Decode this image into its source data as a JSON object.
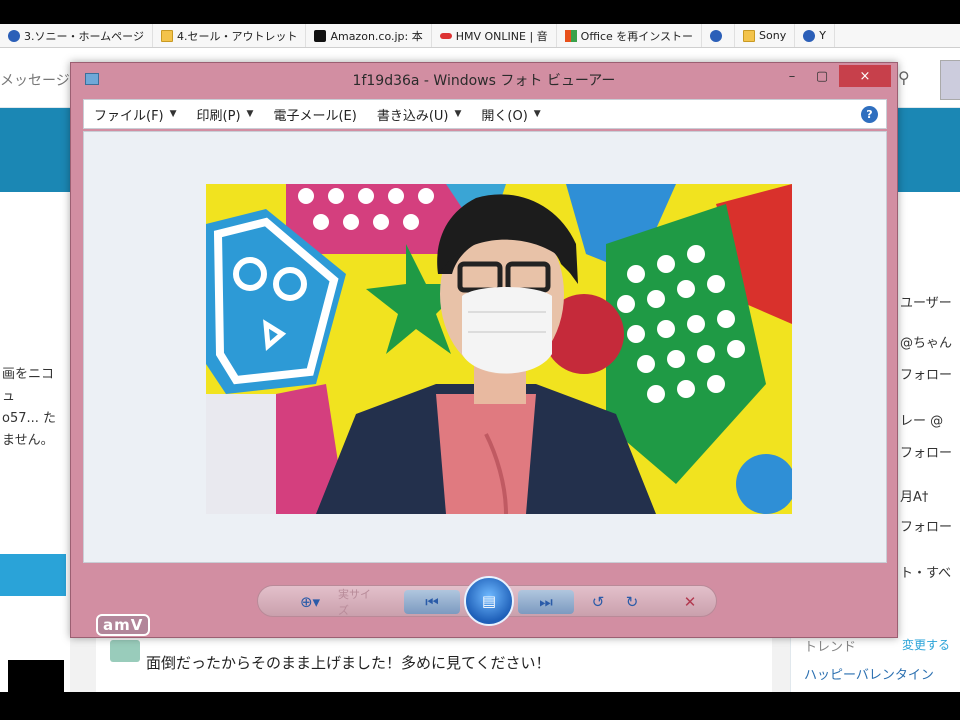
{
  "bookmarks": [
    {
      "label": "3.ソニー・ホームページ",
      "icon": "net-icon"
    },
    {
      "label": "4.セール・アウトレット",
      "icon": "folder-icon"
    },
    {
      "label": "Amazon.co.jp: 本",
      "icon": "amazon-icon"
    },
    {
      "label": "HMV ONLINE | 音",
      "icon": "hmv-icon"
    },
    {
      "label": "Office を再インストー",
      "icon": "office-icon"
    },
    {
      "label": "",
      "icon": "net-icon"
    },
    {
      "label": "Sony",
      "icon": "folder-icon"
    },
    {
      "label": "Y",
      "icon": "net-icon"
    }
  ],
  "twitter": {
    "messages_label": "メッセージ",
    "left_text": "画をニコ\nュ\no57... た\nません。",
    "right_items": [
      "ユーザー",
      "@ちゃん",
      "フォロー",
      "レー @",
      "フォロー",
      "月A†",
      "フォロー",
      "ト・すべ"
    ],
    "feed_text": "面倒だったからそのまま上げました！多めに見てください！",
    "trend_title": "トレンド",
    "trend_change": "変更する",
    "trend_item": "ハッピーバレンタイン"
  },
  "viewer": {
    "title": "1f19d36a - Windows フォト ビューアー",
    "menu": [
      "ファイル(F)",
      "印刷(P)",
      "電子メール(E)",
      "書き込み(U)",
      "開く(O)"
    ],
    "help_label": "?",
    "toolbar": {
      "zoom_icon": "magnifier-icon",
      "size_label": "実サイズ",
      "prev_icon": "previous-icon",
      "play_icon": "slideshow-icon",
      "next_icon": "next-icon",
      "rotate_left_icon": "rotate-left-icon",
      "rotate_right_icon": "rotate-right-icon",
      "delete_icon": "delete-icon"
    },
    "close_label": "×",
    "min_label": "–",
    "max_label": "▢"
  },
  "watermark": "amV"
}
